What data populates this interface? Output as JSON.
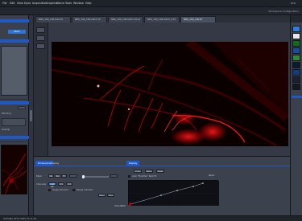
{
  "menubar": {
    "items": [
      "File",
      "Edit",
      "View",
      "Dyes",
      "Acquisition",
      "Graphics",
      "Macro",
      "Tools",
      "Window",
      "Help"
    ],
    "right_text": "ZEN"
  },
  "toolbar": {
    "workspace": "Workspace Configuration"
  },
  "tabs": [
    {
      "label": "NRS_100_100.tiles.tif",
      "active": false
    },
    {
      "label": "NRS_100_100.stitch.tif",
      "active": false
    },
    {
      "label": "NRS_100_100.stitch.tif.czi",
      "active": false
    },
    {
      "label": "NRS_100_100.stitch_2.tif",
      "active": false
    },
    {
      "label": "NRS_100_100.tif",
      "active": true
    }
  ],
  "left_panel": {
    "start_button": "Start",
    "top_label": "Tiles",
    "labels": [
      "Stitching",
      "Overlap",
      "Export"
    ],
    "button2": "Apply"
  },
  "bottom_panel": {
    "tabs": [
      "Dimensions",
      "Display"
    ],
    "right_tab": "Display",
    "labels": {
      "black": "Black",
      "channels": "Channels",
      "white": "White",
      "single_channel": "Single Channel",
      "range_indicator": "Range Indicator",
      "auto": "Auto",
      "gamma": "Gamma"
    },
    "mode_buttons": [
      "Min",
      "Best",
      "Fit"
    ],
    "channel_buttons": [
      "DAPI Ch",
      "Ch2",
      "Ch3"
    ],
    "bottom_buttons": [
      "Reset",
      "Save"
    ],
    "display_buttons": [
      "Linear",
      "Spline",
      "Reset"
    ],
    "reset_label": "Reset",
    "curve_label": "Auto   \"Min/Max\"   Best Fit",
    "gamma_value": "1.00"
  },
  "status": {
    "text": "Ultimate 3073.3345 Yb 11.10"
  }
}
